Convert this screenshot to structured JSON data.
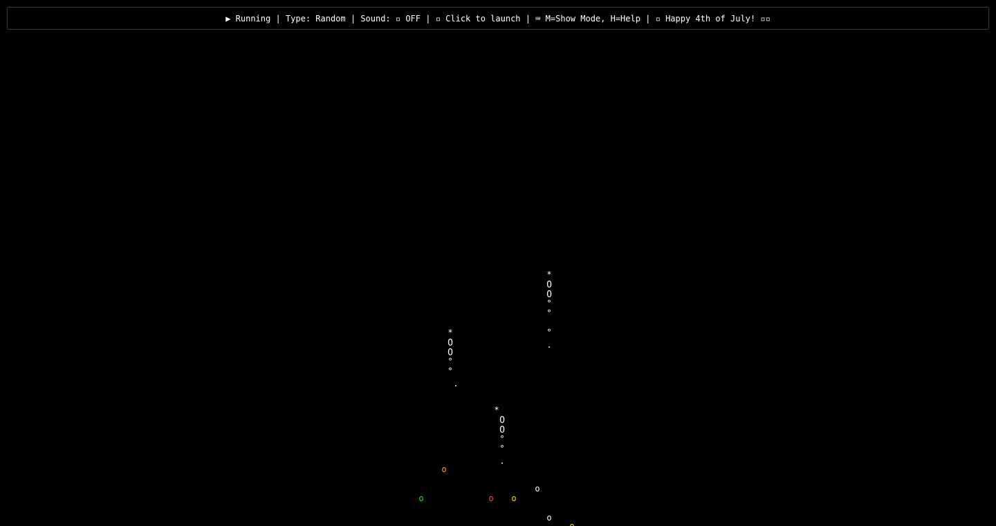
{
  "status_bar": {
    "run_icon": "▶",
    "run_state": "Running",
    "sep": " | ",
    "type_text": "Type: Random",
    "sound_text": "Sound: ▫ OFF",
    "launch_text": "▫ Click to launch",
    "keys_text": "⌨ M=Show Mode, H=Help",
    "greeting_text": "▫ Happy 4th of July! ▫▫"
  },
  "colors": {
    "background": "#000000",
    "text": "#ffffff",
    "border": "#3a3a3a",
    "yellow": "#ffd700",
    "orange": "#ffa500",
    "red": "#ff4444",
    "green": "#22dd22"
  },
  "scene": {
    "rockets": [
      {
        "trail": [
          "*",
          "O",
          "O",
          "°",
          "°",
          "°",
          "."
        ]
      },
      {
        "trail": [
          "*",
          "O",
          "O",
          "°",
          "°",
          "."
        ]
      },
      {
        "trail": [
          "*",
          "O",
          "O",
          "°",
          "°",
          "."
        ]
      }
    ],
    "sparks": [
      {
        "char": "o",
        "color": "orange"
      },
      {
        "char": "o",
        "color": "green"
      },
      {
        "char": "o",
        "color": "red"
      },
      {
        "char": "o",
        "color": "yellow"
      },
      {
        "char": "o",
        "color": "text"
      },
      {
        "char": "o",
        "color": "text"
      },
      {
        "char": "o",
        "color": "yellow"
      }
    ]
  }
}
